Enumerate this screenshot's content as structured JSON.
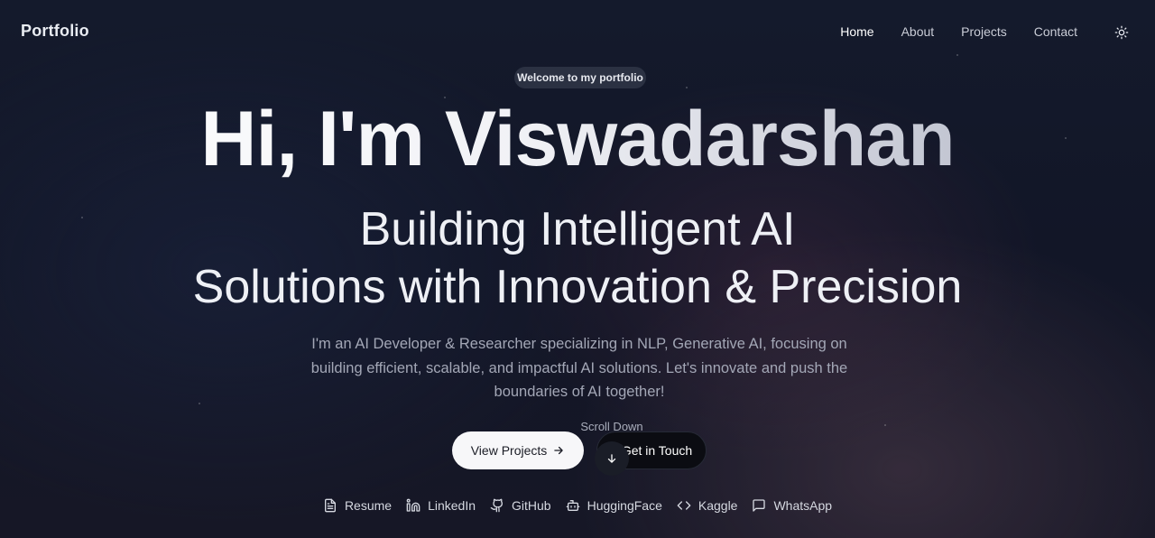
{
  "nav": {
    "brand": "Portfolio",
    "links": [
      "Home",
      "About",
      "Projects",
      "Contact"
    ],
    "active": "Home",
    "theme_toggle_icon": "sun-icon"
  },
  "hero": {
    "badge": "Welcome to my portfolio",
    "title": "Hi, I'm Viswadarshan",
    "subtitle_line1": "Building Intelligent AI",
    "subtitle_line2": "Solutions with Innovation & Precision",
    "description_line1": "I'm an AI Developer & Researcher specializing in NLP, Generative AI, focusing on",
    "description_line2": "building efficient, scalable, and impactful AI solutions. Let's innovate and push the",
    "description_line3": "boundaries of AI together!",
    "primary_button": "View Projects",
    "secondary_button": "Get in Touch",
    "scroll_label": "Scroll Down"
  },
  "socials": [
    {
      "label": "Resume",
      "icon": "file-text-icon"
    },
    {
      "label": "LinkedIn",
      "icon": "linkedin-icon"
    },
    {
      "label": "GitHub",
      "icon": "github-icon"
    },
    {
      "label": "HuggingFace",
      "icon": "bot-icon"
    },
    {
      "label": "Kaggle",
      "icon": "code-icon"
    },
    {
      "label": "WhatsApp",
      "icon": "message-square-icon"
    }
  ],
  "colors": {
    "background": "#131829",
    "primary_button_bg": "#f7f7f9",
    "secondary_button_bg": "#0b0c12",
    "badge_bg": "#2b3142"
  }
}
